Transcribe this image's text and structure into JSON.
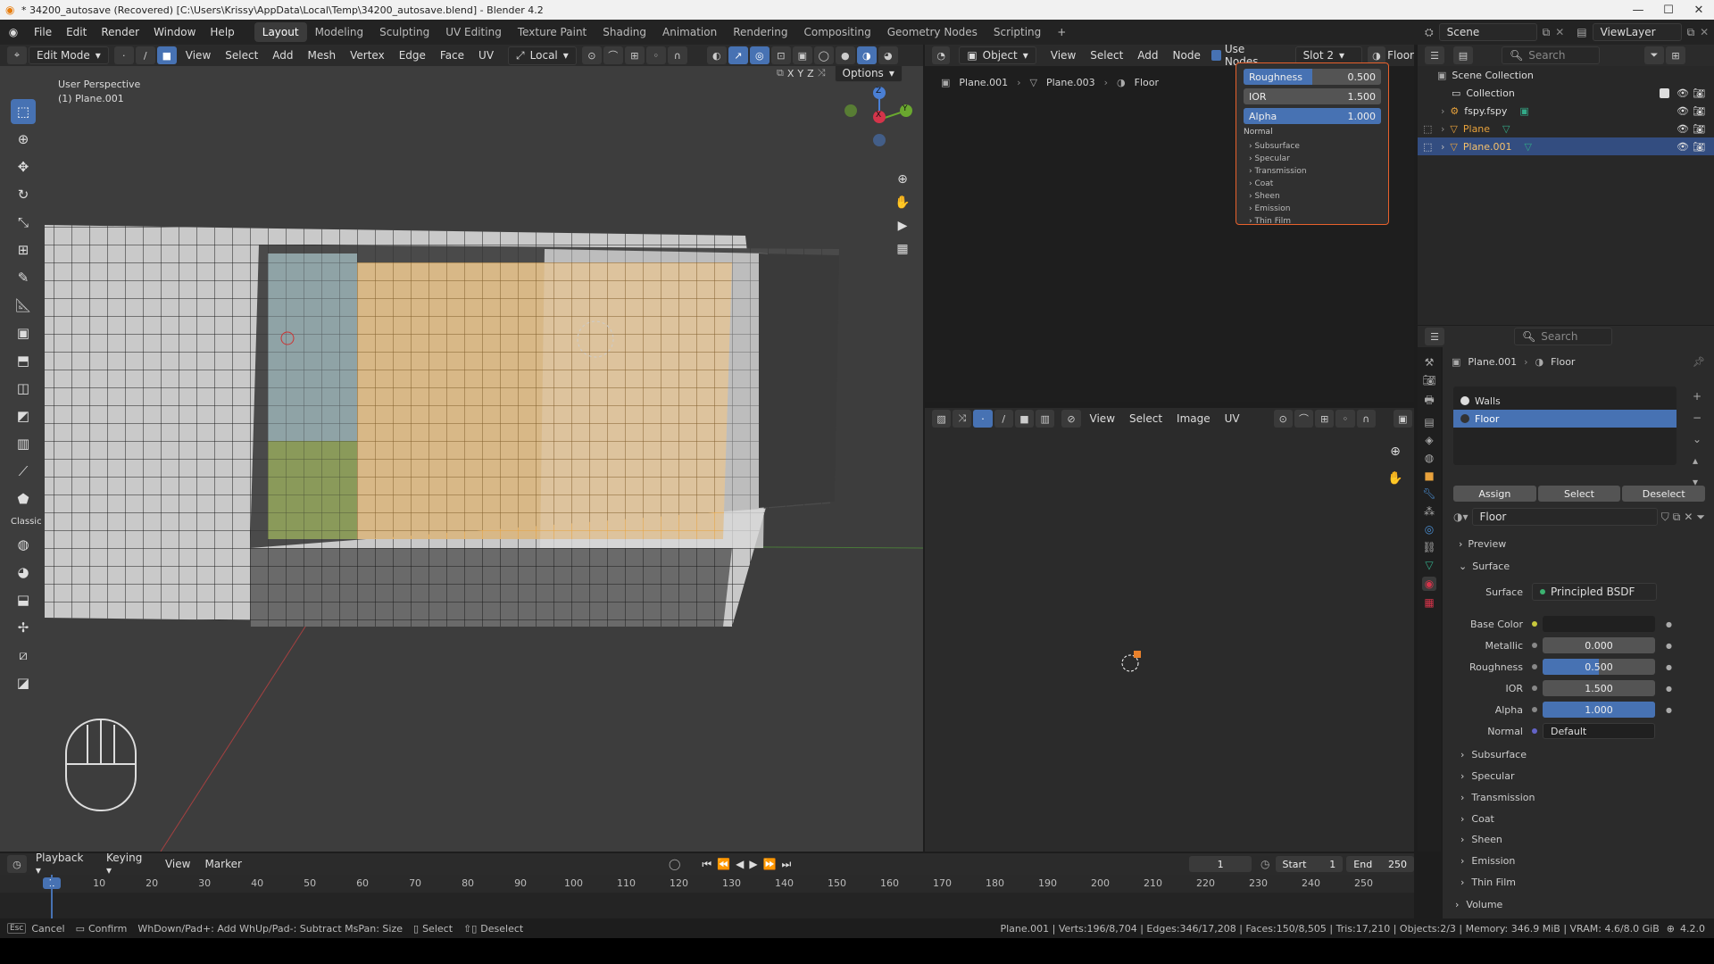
{
  "window": {
    "title": "* 34200_autosave (Recovered) [C:\\Users\\Krissy\\AppData\\Local\\Temp\\34200_autosave.blend] - Blender 4.2"
  },
  "menu": [
    "File",
    "Edit",
    "Render",
    "Window",
    "Help"
  ],
  "workspaces": [
    "Layout",
    "Modeling",
    "Sculpting",
    "UV Editing",
    "Texture Paint",
    "Shading",
    "Animation",
    "Rendering",
    "Compositing",
    "Geometry Nodes",
    "Scripting"
  ],
  "scene": {
    "name": "Scene",
    "view_layer": "ViewLayer"
  },
  "viewport": {
    "mode": "Edit Mode",
    "menus": [
      "View",
      "Select",
      "Add",
      "Mesh",
      "Vertex",
      "Edge",
      "Face",
      "UV"
    ],
    "transform": "Local",
    "options": "Options",
    "axes": [
      "X",
      "Y",
      "Z"
    ],
    "overlay_line1": "User Perspective",
    "overlay_line2": "(1) Plane.001",
    "gizmo": {
      "z": "Z",
      "y": "Y",
      "x": "X"
    },
    "workspace_hint": "Classic"
  },
  "node_editor": {
    "mode": "Object",
    "menus": [
      "View",
      "Select",
      "Add",
      "Node"
    ],
    "use_nodes": "Use Nodes",
    "slot": "Slot 2",
    "material": "Floor",
    "breadcrumb": [
      "Plane.001",
      "Plane.003",
      "Floor"
    ],
    "node_rows": [
      {
        "label": "Roughness",
        "value": "0.500",
        "fill": 0.5
      },
      {
        "label": "IOR",
        "value": "1.500",
        "fill": 0
      },
      {
        "label": "Alpha",
        "value": "1.000",
        "fill": 1
      }
    ],
    "node_normal": "Normal",
    "node_sections": [
      "Subsurface",
      "Specular",
      "Transmission",
      "Coat",
      "Sheen",
      "Emission",
      "Thin Film"
    ]
  },
  "image_editor": {
    "menus": [
      "View",
      "Select",
      "Image",
      "UV"
    ]
  },
  "outliner": {
    "search": "Search",
    "root": "Scene Collection",
    "collection": "Collection",
    "items": [
      {
        "name": "fspy.fspy",
        "selected": false
      },
      {
        "name": "Plane",
        "selected": false
      },
      {
        "name": "Plane.001",
        "selected": true
      }
    ]
  },
  "properties": {
    "search": "Search",
    "breadcrumb": [
      "Plane.001",
      "Floor"
    ],
    "slots": [
      "Walls",
      "Floor"
    ],
    "buttons": {
      "assign": "Assign",
      "select": "Select",
      "deselect": "Deselect"
    },
    "material_name": "Floor",
    "preview": "Preview",
    "surface_header": "Surface",
    "surface_label": "Surface",
    "surface_value": "Principled BSDF",
    "fields": [
      {
        "label": "Base Color",
        "value": "",
        "fill": 0
      },
      {
        "label": "Metallic",
        "value": "0.000",
        "fill": 0
      },
      {
        "label": "Roughness",
        "value": "0.500",
        "fill": 0.5
      },
      {
        "label": "IOR",
        "value": "1.500",
        "fill": 0
      },
      {
        "label": "Alpha",
        "value": "1.000",
        "fill": 1
      }
    ],
    "normal_label": "Normal",
    "normal_value": "Default",
    "sections": [
      "Subsurface",
      "Specular",
      "Transmission",
      "Coat",
      "Sheen",
      "Emission",
      "Thin Film"
    ],
    "volume": "Volume"
  },
  "timeline": {
    "menus": [
      "Playback",
      "Keying",
      "View",
      "Marker"
    ],
    "current_frame": "1",
    "start_label": "Start",
    "start": "1",
    "end_label": "End",
    "end": "250",
    "ticks": [
      "1",
      "10",
      "20",
      "30",
      "40",
      "50",
      "60",
      "70",
      "80",
      "90",
      "100",
      "110",
      "120",
      "130",
      "140",
      "150",
      "160",
      "170",
      "180",
      "190",
      "200",
      "210",
      "220",
      "230",
      "240",
      "250"
    ]
  },
  "statusbar": {
    "left": [
      "Cancel",
      "Confirm",
      "WhDown/Pad+: Add  WhUp/Pad-: Subtract  MsPan: Size",
      "Select",
      "Deselect"
    ],
    "right": "Plane.001 | Verts:196/8,704 | Edges:346/17,208 | Faces:150/8,505 | Tris:17,210 | Objects:2/3 | Memory: 346.9 MiB | VRAM: 4.6/8.0 GiB",
    "version": "4.2.0"
  },
  "colors": {
    "accent": "#4772b3",
    "selection": "#e8a23c",
    "bg": "#3d3d3d"
  }
}
